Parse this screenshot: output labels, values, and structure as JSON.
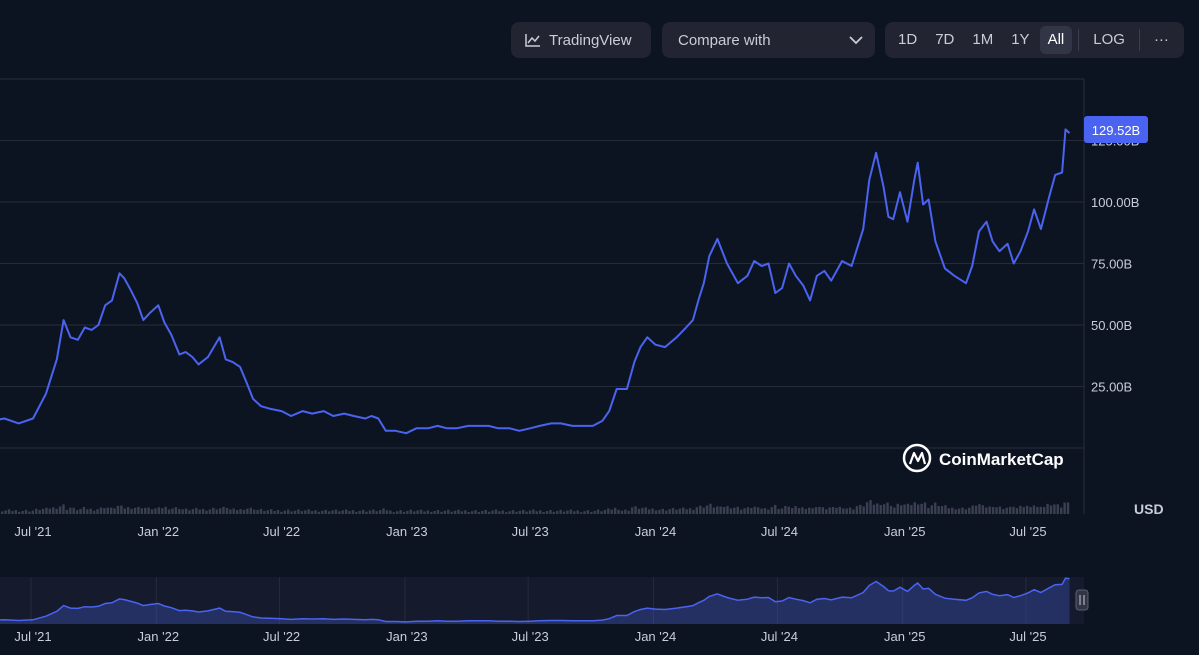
{
  "toolbar": {
    "tradingview_label": "TradingView",
    "compare_label": "Compare with",
    "ranges": [
      "1D",
      "7D",
      "1M",
      "1Y",
      "All"
    ],
    "active_range": "All",
    "log_label": "LOG",
    "more_label": "···"
  },
  "watermark": "CoinMarketCap",
  "currency_label": "USD",
  "current_value_label": "129.52B",
  "colors": {
    "line": "#4a63f0",
    "background": "#0d1421",
    "grid": "#262b3a",
    "badge": "#4a63f0"
  },
  "chart_data": {
    "type": "line",
    "title": "",
    "xlabel": "",
    "ylabel": "",
    "y_unit": "USD",
    "y_ticks": [
      25,
      50,
      75,
      100,
      125
    ],
    "y_tick_labels": [
      "25.00B",
      "50.00B",
      "75.00B",
      "100.00B",
      "125.00B"
    ],
    "ylim": [
      0,
      150
    ],
    "x_tick_labels": [
      "Jul '21",
      "Jan '22",
      "Jul '22",
      "Jan '23",
      "Jul '23",
      "Jan '24",
      "Jul '24",
      "Jan '25",
      "Jul '25"
    ],
    "grid": true,
    "series": [
      {
        "values_unit": "billion USD",
        "x": [
          "2021-04-15",
          "2021-05-01",
          "2021-05-20",
          "2021-06-10",
          "2021-07-01",
          "2021-07-20",
          "2021-08-05",
          "2021-08-15",
          "2021-08-25",
          "2021-09-05",
          "2021-09-15",
          "2021-09-25",
          "2021-10-05",
          "2021-10-15",
          "2021-10-25",
          "2021-11-05",
          "2021-11-12",
          "2021-11-20",
          "2021-12-01",
          "2021-12-10",
          "2021-12-20",
          "2022-01-01",
          "2022-01-10",
          "2022-01-20",
          "2022-02-01",
          "2022-02-10",
          "2022-02-20",
          "2022-03-01",
          "2022-03-15",
          "2022-04-01",
          "2022-04-10",
          "2022-04-20",
          "2022-05-01",
          "2022-05-10",
          "2022-05-20",
          "2022-06-01",
          "2022-06-13",
          "2022-07-01",
          "2022-07-15",
          "2022-08-01",
          "2022-08-15",
          "2022-09-01",
          "2022-09-15",
          "2022-10-01",
          "2022-10-15",
          "2022-11-01",
          "2022-11-10",
          "2022-11-20",
          "2022-12-01",
          "2022-12-15",
          "2022-12-31",
          "2023-01-15",
          "2023-02-01",
          "2023-02-15",
          "2023-03-01",
          "2023-03-15",
          "2023-04-01",
          "2023-04-15",
          "2023-05-01",
          "2023-05-15",
          "2023-06-01",
          "2023-06-15",
          "2023-07-01",
          "2023-07-15",
          "2023-08-01",
          "2023-08-15",
          "2023-09-01",
          "2023-09-15",
          "2023-10-01",
          "2023-10-15",
          "2023-10-25",
          "2023-11-05",
          "2023-11-20",
          "2023-12-01",
          "2023-12-10",
          "2023-12-20",
          "2024-01-01",
          "2024-01-15",
          "2024-02-01",
          "2024-02-15",
          "2024-02-25",
          "2024-03-05",
          "2024-03-12",
          "2024-03-20",
          "2024-04-01",
          "2024-04-15",
          "2024-05-01",
          "2024-05-15",
          "2024-05-25",
          "2024-06-05",
          "2024-06-15",
          "2024-06-25",
          "2024-07-05",
          "2024-07-15",
          "2024-07-25",
          "2024-08-05",
          "2024-08-15",
          "2024-08-25",
          "2024-09-05",
          "2024-09-15",
          "2024-10-01",
          "2024-10-15",
          "2024-11-01",
          "2024-11-10",
          "2024-11-20",
          "2024-12-01",
          "2024-12-08",
          "2024-12-15",
          "2024-12-25",
          "2025-01-05",
          "2025-01-15",
          "2025-01-20",
          "2025-01-28",
          "2025-02-05",
          "2025-02-15",
          "2025-03-01",
          "2025-03-15",
          "2025-04-01",
          "2025-04-10",
          "2025-04-20",
          "2025-05-01",
          "2025-05-10",
          "2025-05-20",
          "2025-06-01",
          "2025-06-10",
          "2025-06-20",
          "2025-07-01",
          "2025-07-10",
          "2025-07-20",
          "2025-08-01",
          "2025-08-10",
          "2025-08-20",
          "2025-08-25",
          "2025-08-31"
        ],
        "values": [
          13,
          11,
          12,
          10,
          12,
          22,
          36,
          52,
          45,
          44,
          49,
          48,
          50,
          58,
          60,
          71,
          69,
          65,
          59,
          52,
          55,
          58,
          51,
          46,
          38,
          39,
          37,
          34,
          37,
          45,
          36,
          35,
          33,
          27,
          20,
          17,
          16,
          15,
          13,
          15,
          14,
          15,
          13,
          14,
          13,
          12,
          13,
          12,
          7,
          7,
          6,
          8,
          8,
          9,
          8,
          8,
          9,
          9,
          9,
          8,
          8,
          7,
          8,
          9,
          10,
          10,
          9,
          9,
          9,
          11,
          15,
          24,
          24,
          35,
          41,
          45,
          42,
          41,
          45,
          49,
          52,
          61,
          67,
          78,
          85,
          75,
          67,
          70,
          76,
          74,
          75,
          63,
          65,
          75,
          70,
          66,
          60,
          70,
          72,
          68,
          76,
          74,
          89,
          109,
          120,
          106,
          94,
          93,
          104,
          92,
          109,
          116,
          99,
          101,
          84,
          73,
          70,
          67,
          74,
          88,
          92,
          84,
          80,
          83,
          75,
          80,
          88,
          97,
          89,
          102,
          111,
          112,
          129.52,
          128
        ]
      }
    ]
  },
  "navigator": {
    "x_tick_labels": [
      "Jul '21",
      "Jan '22",
      "Jul '22",
      "Jan '23",
      "Jul '23",
      "Jan '24",
      "Jul '24",
      "Jan '25",
      "Jul '25"
    ]
  }
}
